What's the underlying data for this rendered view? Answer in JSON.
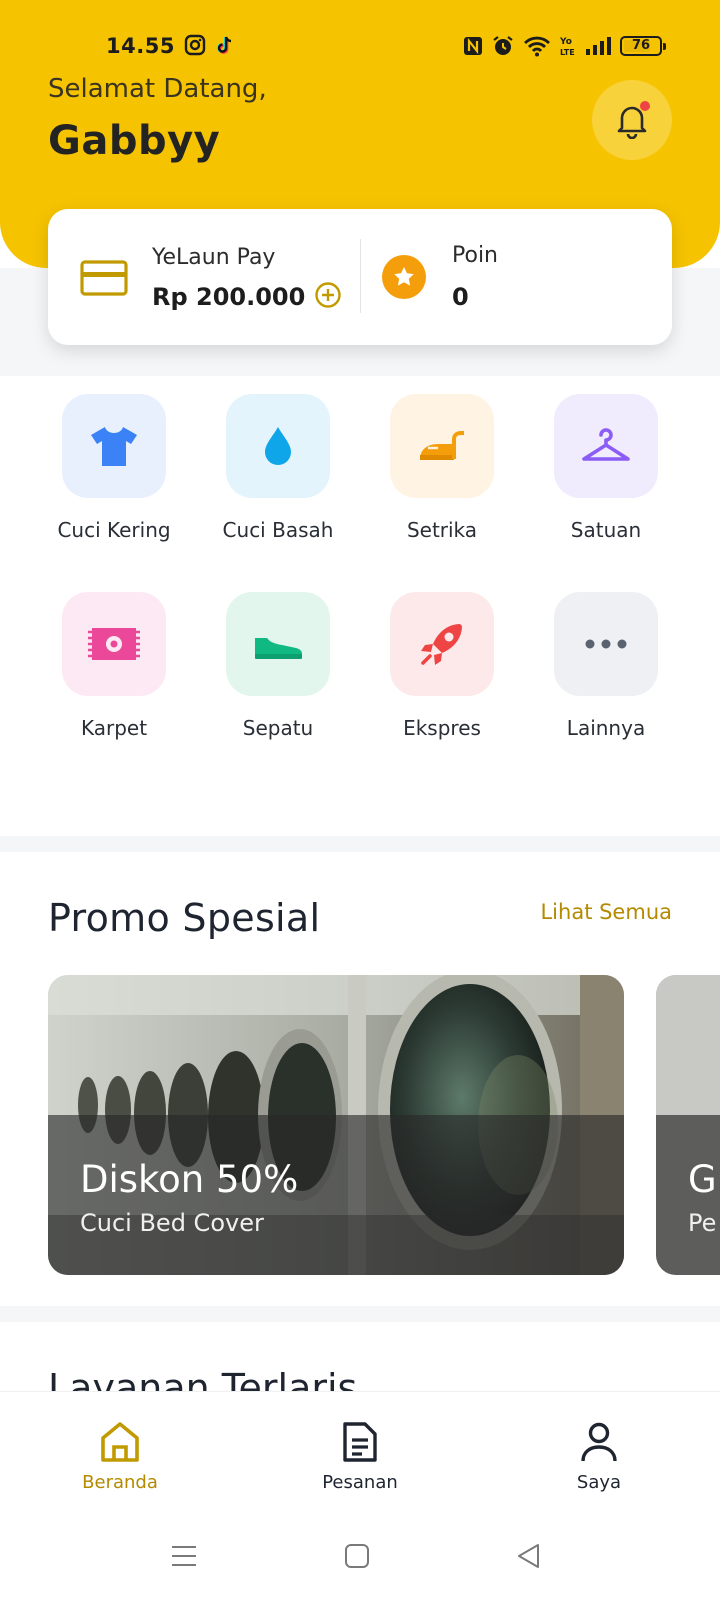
{
  "status_bar": {
    "time": "14.55",
    "battery": "76",
    "battery_level": 0.76
  },
  "header": {
    "greeting": "Selamat Datang,",
    "username": "Gabbyy"
  },
  "wallet": {
    "label": "YeLaun Pay",
    "amount": "Rp 200.000"
  },
  "points": {
    "label": "Poin",
    "value": "0"
  },
  "services": [
    {
      "label": "Cuci Kering",
      "icon": "shirt-icon",
      "color": "#e8f0fe"
    },
    {
      "label": "Cuci Basah",
      "icon": "water-drop-icon",
      "color": "#e3f4fc"
    },
    {
      "label": "Setrika",
      "icon": "iron-icon",
      "color": "#fff3e3"
    },
    {
      "label": "Satuan",
      "icon": "hanger-icon",
      "color": "#f0ebfd"
    },
    {
      "label": "Karpet",
      "icon": "carpet-icon",
      "color": "#fde9f3"
    },
    {
      "label": "Sepatu",
      "icon": "shoe-icon",
      "color": "#e3f6ee"
    },
    {
      "label": "Ekspres",
      "icon": "rocket-icon",
      "color": "#fde9ea"
    },
    {
      "label": "Lainnya",
      "icon": "more-dots-icon",
      "color": "#eff0f3"
    }
  ],
  "promo": {
    "title": "Promo Spesial",
    "see_all": "Lihat Semua",
    "cards": [
      {
        "headline": "Diskon 50%",
        "subtitle": "Cuci Bed Cover"
      },
      {
        "headline": "G",
        "subtitle": "Pe"
      }
    ]
  },
  "best_services": {
    "title": "Layanan Terlaris"
  },
  "bottom_nav": [
    {
      "label": "Beranda",
      "icon": "home-icon",
      "active": true
    },
    {
      "label": "Pesanan",
      "icon": "document-icon",
      "active": false
    },
    {
      "label": "Saya",
      "icon": "user-icon",
      "active": false
    }
  ],
  "colors": {
    "brand_yellow": "#f5c300",
    "accent_gold": "#b38a00",
    "dark_text": "#1f2530"
  }
}
